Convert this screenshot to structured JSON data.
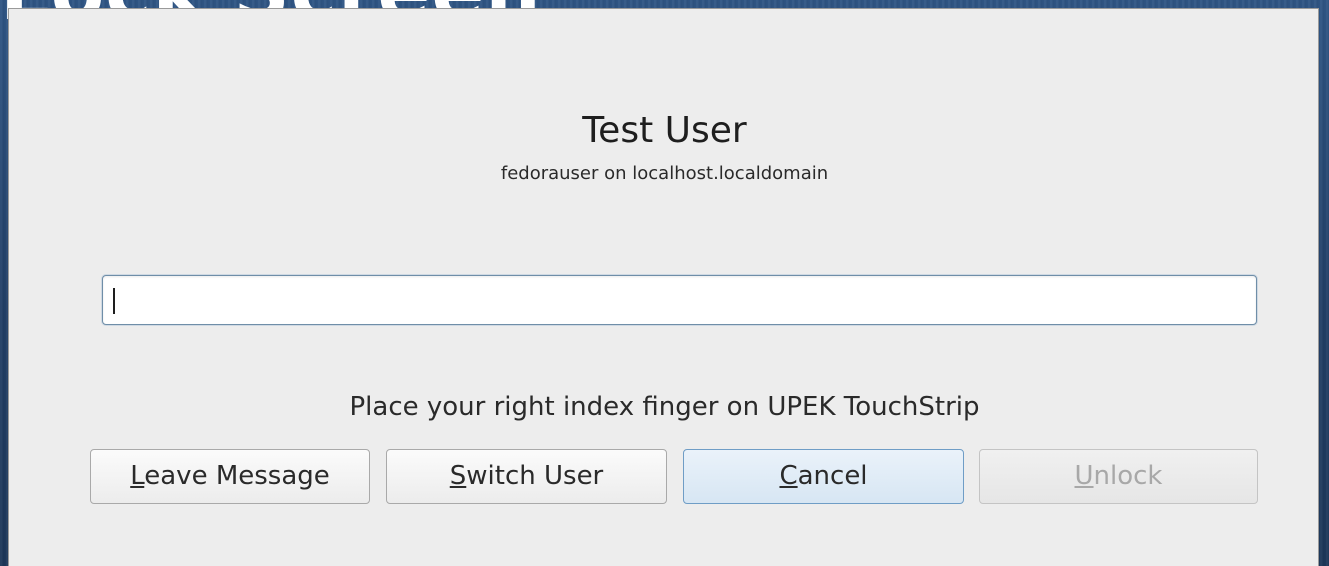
{
  "background": {
    "title_text": "Lock Screen"
  },
  "dialog": {
    "user_name": "Test User",
    "user_host": "fedorauser on localhost.localdomain",
    "password_value": "",
    "status_message": "Place your right index finger on UPEK TouchStrip",
    "buttons": {
      "leave_message": {
        "mnemonic": "L",
        "rest": "eave Message",
        "enabled": true
      },
      "switch_user": {
        "mnemonic": "S",
        "rest": "witch User",
        "enabled": true
      },
      "cancel": {
        "mnemonic": "C",
        "rest": "ancel",
        "enabled": true,
        "default": true
      },
      "unlock": {
        "mnemonic": "U",
        "rest": "nlock",
        "enabled": false
      }
    }
  },
  "colors": {
    "dialog_bg": "#ededed",
    "focus_border": "#6f9dc6",
    "disabled_text": "#a8a8a8",
    "desktop_bg": "#2a4a72"
  }
}
